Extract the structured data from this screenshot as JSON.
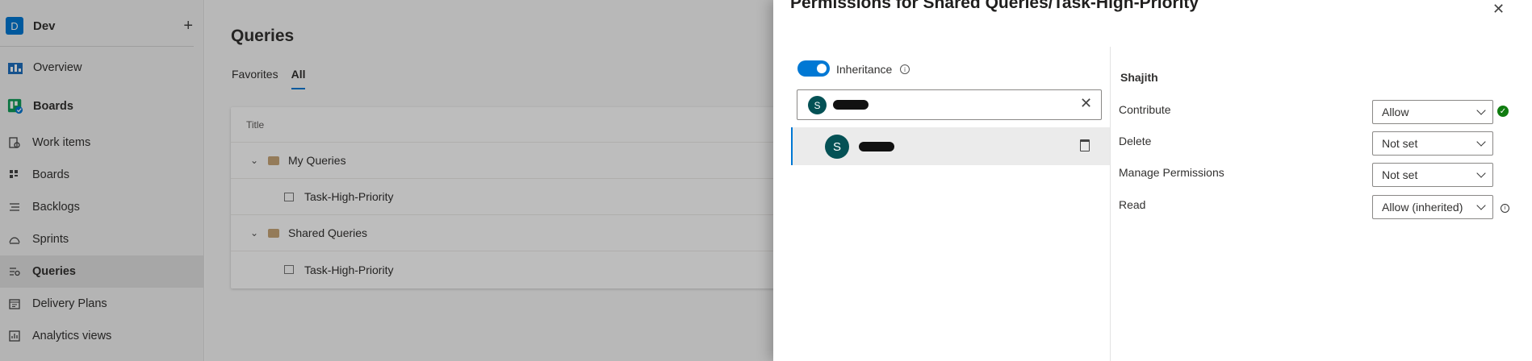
{
  "project": {
    "initial": "D",
    "name": "Dev",
    "add_glyph": "+"
  },
  "nav": [
    {
      "label": "Overview",
      "icon": "overview-icon"
    },
    {
      "label": "Boards",
      "icon": "boards-hub-icon"
    },
    {
      "label": "Work items",
      "icon": "work-items-icon"
    },
    {
      "label": "Boards",
      "icon": "board-icon"
    },
    {
      "label": "Backlogs",
      "icon": "backlogs-icon"
    },
    {
      "label": "Sprints",
      "icon": "sprints-icon"
    },
    {
      "label": "Queries",
      "icon": "queries-icon"
    },
    {
      "label": "Delivery Plans",
      "icon": "delivery-plans-icon"
    },
    {
      "label": "Analytics views",
      "icon": "analytics-icon"
    }
  ],
  "main": {
    "title": "Queries",
    "tabs": [
      {
        "label": "Favorites"
      },
      {
        "label": "All"
      }
    ],
    "table": {
      "header": "Title",
      "rows": [
        {
          "label": "My Queries",
          "kind": "folder"
        },
        {
          "label": "Task-High-Priority",
          "kind": "query"
        },
        {
          "label": "Shared Queries",
          "kind": "folder"
        },
        {
          "label": "Task-High-Priority",
          "kind": "query"
        }
      ]
    }
  },
  "panel": {
    "title": "Permissions for Shared Queries/Task-High-Priority",
    "close_glyph": "✕",
    "inheritance_label": "Inheritance",
    "identity_initial": "S",
    "selected_user": "Shajith",
    "permissions": [
      {
        "name": "Contribute",
        "value": "Allow"
      },
      {
        "name": "Delete",
        "value": "Not set"
      },
      {
        "name": "Manage Permissions",
        "value": "Not set"
      },
      {
        "name": "Read",
        "value": "Allow (inherited)"
      }
    ]
  },
  "colors": {
    "accent": "#0078d4",
    "avatar": "#045155",
    "success": "#107c10"
  }
}
